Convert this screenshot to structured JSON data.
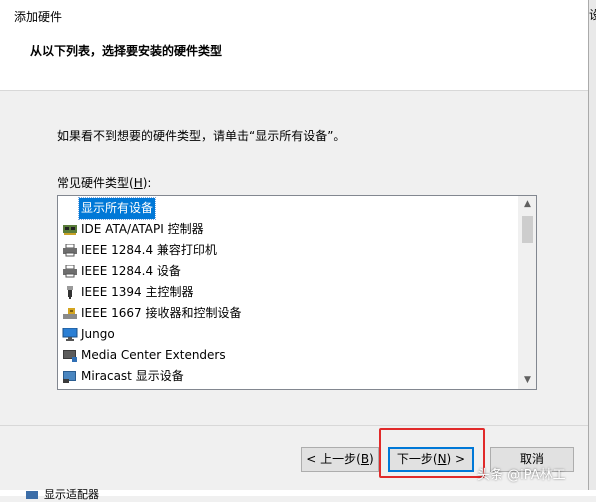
{
  "window": {
    "title": "添加硬件"
  },
  "header": {
    "heading": "从以下列表，选择要安装的硬件类型"
  },
  "content": {
    "instruction": "如果看不到想要的硬件类型，请单击“显示所有设备”。",
    "list_label_prefix": "常见硬件类型(",
    "list_label_access": "H",
    "list_label_suffix": "):"
  },
  "hardware_list": {
    "items": [
      {
        "label": "显示所有设备",
        "icon": "none",
        "selected": true
      },
      {
        "label": "IDE ATA/ATAPI 控制器",
        "icon": "ide-controller-icon"
      },
      {
        "label": "IEEE 1284.4 兼容打印机",
        "icon": "printer-icon"
      },
      {
        "label": "IEEE 1284.4 设备",
        "icon": "printer-icon"
      },
      {
        "label": "IEEE 1394 主控制器",
        "icon": "usb-plug-icon"
      },
      {
        "label": "IEEE 1667 接收器和控制设备",
        "icon": "usb-drive-icon"
      },
      {
        "label": "Jungo",
        "icon": "monitor-icon"
      },
      {
        "label": "Media Center Extenders",
        "icon": "media-device-icon"
      },
      {
        "label": "Miracast 显示设备",
        "icon": "display-device-icon"
      }
    ]
  },
  "buttons": {
    "back_prefix": "< 上一步(",
    "back_access": "B",
    "back_suffix": ")",
    "next_prefix": "下一步(",
    "next_access": "N",
    "next_suffix": ") >",
    "cancel": "取消"
  },
  "background": {
    "partial_item": "显示适配器",
    "right_edge_char": "设"
  },
  "watermark": "头条 @iPA林工",
  "colors": {
    "selection": "#0078d7",
    "highlight_box": "#e12a2a",
    "window_bg": "#f0f0f0"
  }
}
